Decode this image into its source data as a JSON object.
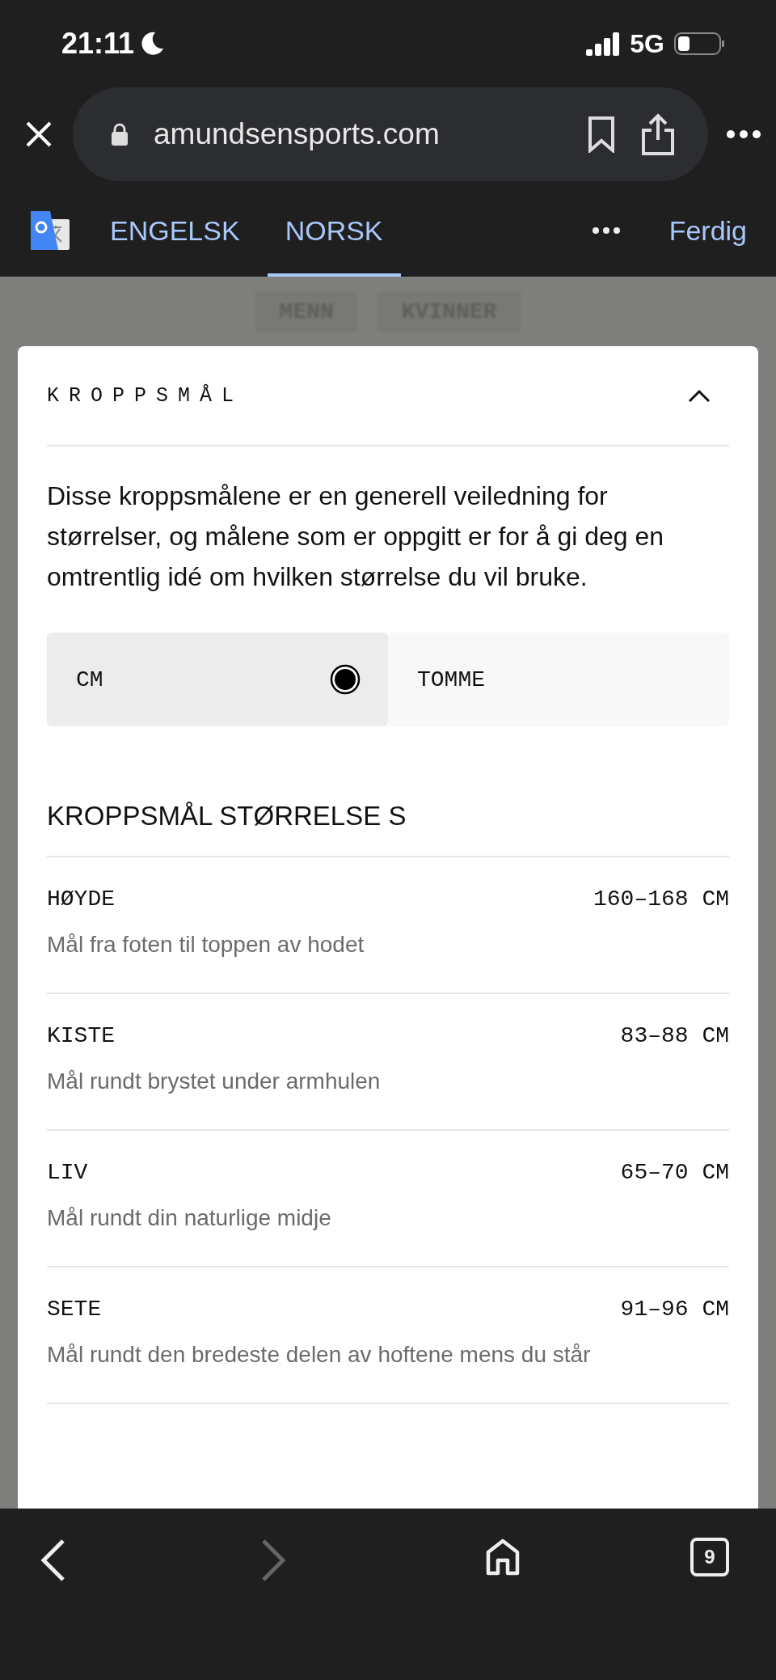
{
  "status_bar": {
    "time": "21:11",
    "network": "5G"
  },
  "browser": {
    "url": "amundsensports.com"
  },
  "translate_bar": {
    "languages": [
      {
        "label": "ENGELSK",
        "selected": false
      },
      {
        "label": "NORSK",
        "selected": true
      }
    ],
    "done": "Ferdig"
  },
  "background_tabs": [
    "MENN",
    "KVINNER"
  ],
  "sheet": {
    "title": "KROPPSMÅL",
    "expanded": true,
    "intro": "Disse kroppsmålene er en generell veiledning for størrelser, og målene som er oppgitt er for å gi deg en omtrentlig idé om hvilken størrelse du vil bruke.",
    "units": [
      {
        "label": "CM",
        "selected": true
      },
      {
        "label": "TOMME",
        "selected": false
      }
    ],
    "heading": "KROPPSMÅL STØRRELSE S",
    "measurements": [
      {
        "name": "HØYDE",
        "value": "160–168 CM",
        "description": "Mål fra foten til toppen av hodet"
      },
      {
        "name": "KISTE",
        "value": "83–88 CM",
        "description": "Mål rundt brystet under armhulen"
      },
      {
        "name": "LIV",
        "value": "65–70 CM",
        "description": "Mål rundt din naturlige midje"
      },
      {
        "name": "SETE",
        "value": "91–96 CM",
        "description": "Mål rundt den bredeste delen av hoftene mens du står"
      }
    ]
  },
  "tab_count": "9"
}
